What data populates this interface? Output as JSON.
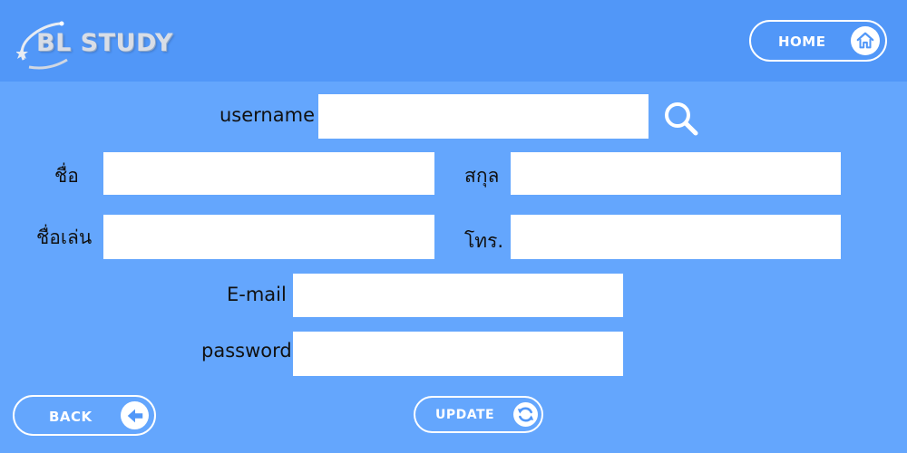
{
  "header": {
    "logo_text": "BL STUDY",
    "home_label": "HOME",
    "home_icon": "home-icon"
  },
  "form": {
    "username_label": "username",
    "username_value": "",
    "search_icon": "search-icon",
    "first_name_label": "ชื่อ",
    "first_name_value": "",
    "last_name_label": "สกุล",
    "last_name_value": "",
    "nickname_label": "ชื่อเล่น",
    "nickname_value": "",
    "phone_label": "โทร.",
    "phone_value": "",
    "email_label": "E-mail",
    "email_value": "",
    "password_label": "password",
    "password_value": ""
  },
  "footer": {
    "back_label": "BACK",
    "back_icon": "arrow-left-icon",
    "update_label": "UPDATE",
    "update_icon": "refresh-icon"
  },
  "colors": {
    "background": "#64a6fd",
    "header_background": "#5197f8",
    "field_background": "#ffffff",
    "button_outline": "#ffffff"
  }
}
